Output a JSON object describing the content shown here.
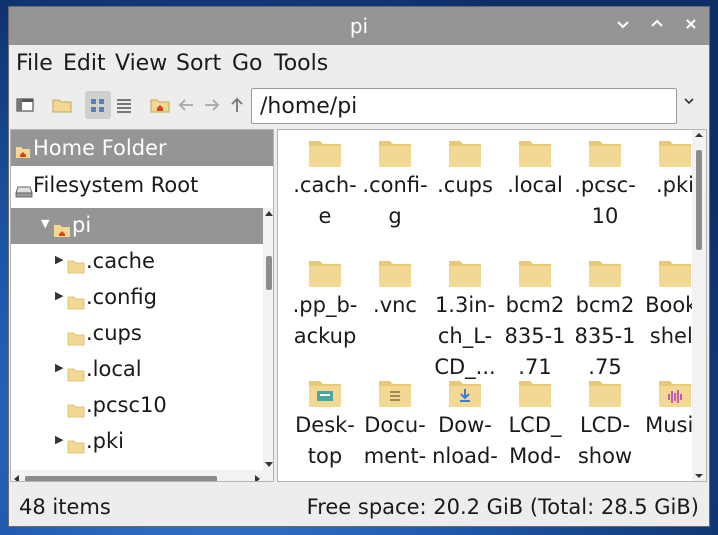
{
  "window": {
    "title": "pi"
  },
  "titlebar_buttons": [
    "minimize",
    "maximize",
    "close"
  ],
  "menu": [
    "File",
    "Edit",
    "View",
    "Sort",
    "Go",
    "Tools"
  ],
  "toolbar": {
    "path": "/home/pi"
  },
  "places": [
    {
      "label": "Home Folder",
      "icon": "home-icon",
      "selected": true
    },
    {
      "label": "Filesystem Root",
      "icon": "drive-icon",
      "selected": false
    }
  ],
  "tree": [
    {
      "label": "pi",
      "expanded": true,
      "selected": true
    },
    {
      "label": ".cache",
      "has_children": true
    },
    {
      "label": ".config",
      "has_children": true
    },
    {
      "label": ".cups",
      "has_children": false
    },
    {
      "label": ".local",
      "has_children": true
    },
    {
      "label": ".pcsc10",
      "has_children": false
    },
    {
      "label": ".pki",
      "has_children": true
    }
  ],
  "files": [
    {
      "name": ".cach-\ne",
      "icon": "folder-icon"
    },
    {
      "name": ".confi-\ng",
      "icon": "folder-icon"
    },
    {
      "name": ".cups",
      "icon": "folder-icon"
    },
    {
      "name": ".local",
      "icon": "folder-icon"
    },
    {
      "name": ".pcsc-\n10",
      "icon": "folder-icon"
    },
    {
      "name": ".pki",
      "icon": "folder-icon"
    },
    {
      "name": ".pp_b-\nackup",
      "icon": "folder-icon"
    },
    {
      "name": ".vnc",
      "icon": "folder-icon"
    },
    {
      "name": "1.3in-\nch_L-\nCD_...",
      "icon": "folder-icon"
    },
    {
      "name": "bcm2\n835-1\n.71",
      "icon": "folder-icon"
    },
    {
      "name": "bcm2\n835-1\n.75",
      "icon": "folder-icon"
    },
    {
      "name": "Book-\nshelf",
      "icon": "folder-icon"
    },
    {
      "name": "Desk-\ntop",
      "icon": "desktop-folder-icon"
    },
    {
      "name": "Docu-\nment-",
      "icon": "documents-folder-icon"
    },
    {
      "name": "Dow-\nnload-",
      "icon": "downloads-folder-icon"
    },
    {
      "name": "LCD_\nMod-",
      "icon": "folder-icon"
    },
    {
      "name": "LCD-\nshow",
      "icon": "folder-icon"
    },
    {
      "name": "Music",
      "icon": "music-folder-icon"
    }
  ],
  "status": {
    "items": "48 items",
    "space": "Free space: 20.2 GiB (Total: 28.5 GiB)"
  },
  "colors": {
    "titlebar": "#959595",
    "selection": "#959595",
    "folder": "#f3d893",
    "folder_dark": "#e8c976"
  }
}
